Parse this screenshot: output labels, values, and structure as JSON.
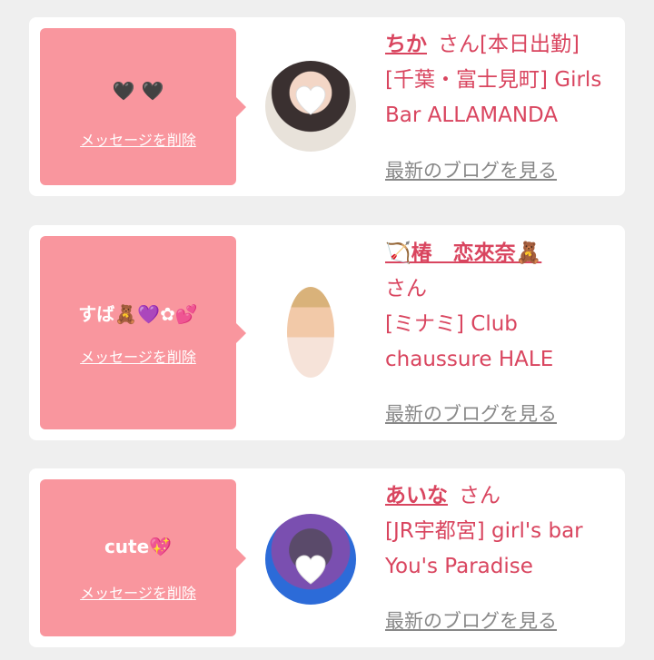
{
  "items": [
    {
      "message": "🖤 🖤",
      "delete_label": "メッセージを削除",
      "name": "ちか",
      "san": "さん[本日出勤]",
      "shop": "[千葉・富士見町] Girls Bar ALLAMANDA",
      "blog_label": "最新のブログを見る",
      "avatar": "avatar-photo"
    },
    {
      "message": "すば🧸💜✿💕",
      "delete_label": "メッセージを削除",
      "name": "🏹椿　恋來奈🧸",
      "san": "さん",
      "shop_line1": "[ミナミ] Club",
      "shop_line2": "chaussure HALE",
      "blog_label": "最新のブログを見る",
      "avatar": "avatar-photo"
    },
    {
      "message": "cute💖",
      "delete_label": "メッセージを削除",
      "name": "あいな",
      "san": "さん",
      "shop": "[JR宇都宮] girl's bar You's Paradise",
      "blog_label": "最新のブログを見る",
      "avatar": "avatar-photo"
    }
  ],
  "colors": {
    "background": "#efefef",
    "card": "#ffffff",
    "message_box": "#f9969e",
    "accent_text": "#d9455f",
    "link_gray": "#888888"
  }
}
